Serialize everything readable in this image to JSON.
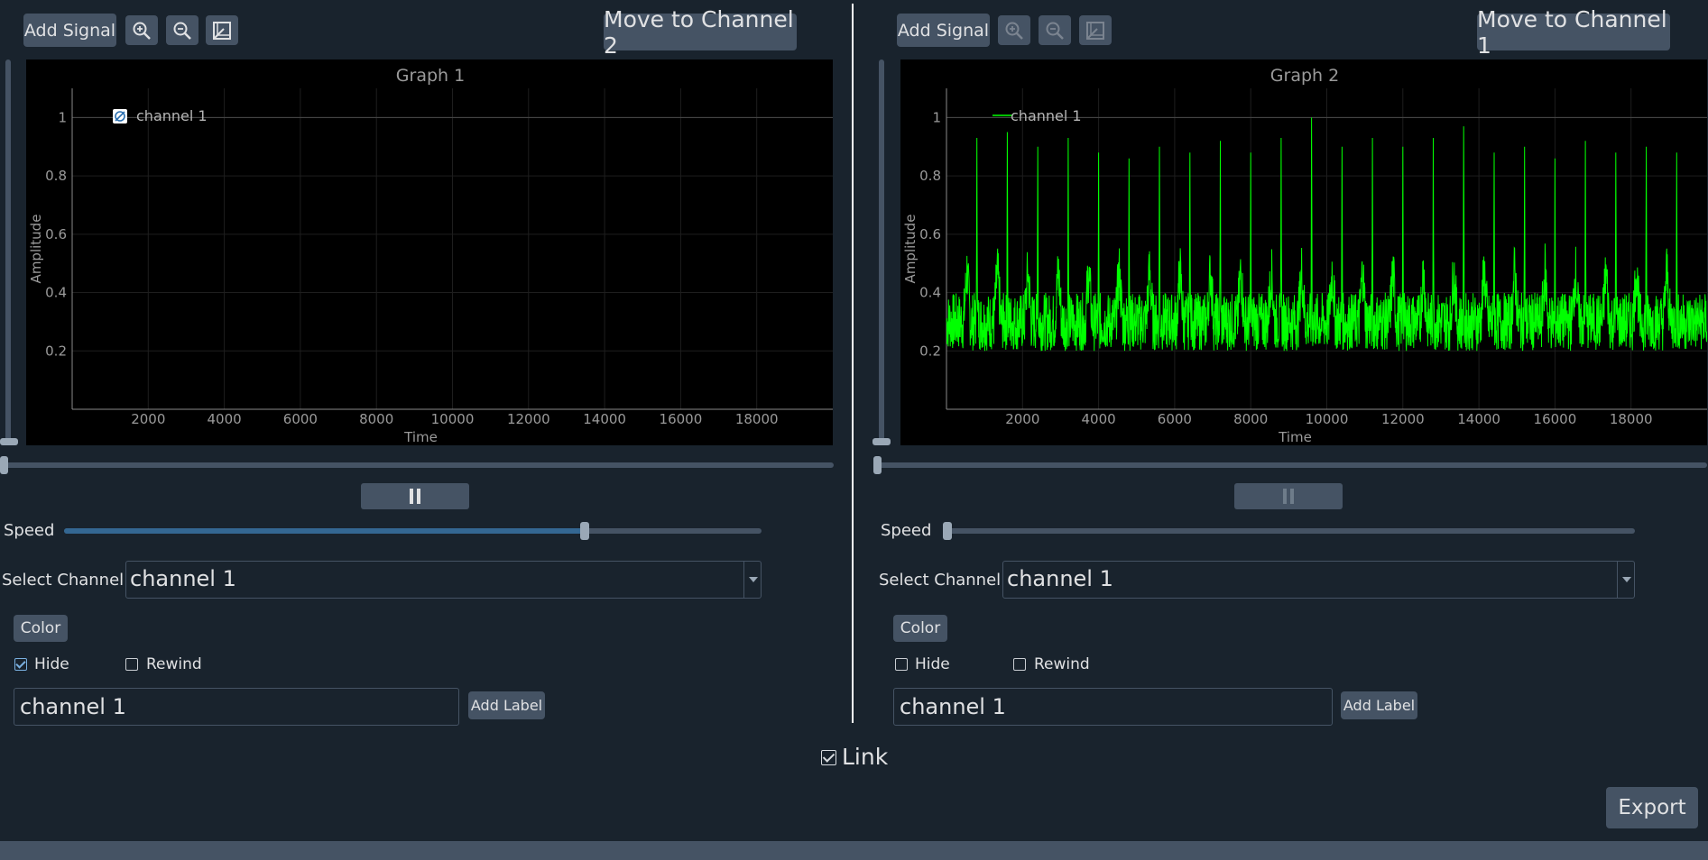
{
  "panels": [
    {
      "add_signal": "Add Signal",
      "move_to": "Move to Channel 2",
      "graph_title": "Graph 1",
      "y_axis_label": "Amplitude",
      "x_axis_label": "Time",
      "legend": "channel 1",
      "legend_state": "hidden",
      "select_channel_label": "Select Channel",
      "selected_channel": "channel 1",
      "color_button": "Color",
      "hide_label": "Hide",
      "hide_checked": true,
      "rewind_label": "Rewind",
      "rewind_checked": false,
      "label_input_value": "channel 1",
      "add_label": "Add Label",
      "speed_label": "Speed",
      "speed_fraction": 0.75
    },
    {
      "add_signal": "Add Signal",
      "move_to": "Move to Channel 1",
      "graph_title": "Graph 2",
      "y_axis_label": "Amplitude",
      "x_axis_label": "Time",
      "legend": "channel 1",
      "legend_state": "visible",
      "select_channel_label": "Select Channel",
      "selected_channel": "channel 1",
      "color_button": "Color",
      "hide_label": "Hide",
      "hide_checked": false,
      "rewind_label": "Rewind",
      "rewind_checked": false,
      "label_input_value": "channel 1",
      "add_label": "Add Label",
      "speed_label": "Speed",
      "speed_fraction": 0.0
    }
  ],
  "axis": {
    "x_ticks": [
      "2000",
      "4000",
      "6000",
      "8000",
      "10000",
      "12000",
      "14000",
      "16000",
      "18000"
    ],
    "x_tick_values": [
      2000,
      4000,
      6000,
      8000,
      10000,
      12000,
      14000,
      16000,
      18000
    ],
    "x_range": [
      0,
      20000
    ],
    "y_ticks": [
      "0.2",
      "0.4",
      "0.6",
      "0.8",
      "1"
    ],
    "y_tick_values": [
      0.2,
      0.4,
      0.6,
      0.8,
      1.0
    ],
    "y_range": [
      0,
      1.1
    ]
  },
  "signal": {
    "color": "#00ff00",
    "baseline": 0.3,
    "noise_amplitude": 0.1,
    "peak_times": [
      800,
      1600,
      2400,
      3200,
      4000,
      4800,
      5600,
      6400,
      7200,
      8000,
      8800,
      9600,
      10400,
      11200,
      12000,
      12800,
      13600,
      14400,
      15200,
      16000,
      16800,
      17600,
      18400,
      19200
    ],
    "peak_values": [
      0.93,
      0.95,
      0.9,
      0.93,
      0.88,
      0.86,
      0.9,
      0.88,
      0.92,
      0.88,
      0.93,
      1.0,
      0.9,
      0.93,
      0.9,
      0.93,
      0.97,
      0.88,
      0.9,
      0.86,
      0.92,
      0.88,
      0.9,
      0.88
    ]
  },
  "link_label": "Link",
  "link_checked": true,
  "export": "Export",
  "colors": {
    "background": "#19232d",
    "button": "#455364",
    "accent": "#346792",
    "plot_bg": "#000000"
  },
  "icons": [
    "zoom-in-icon",
    "zoom-out-icon",
    "fit-view-icon",
    "pause-icon",
    "hidden-legend-icon"
  ]
}
